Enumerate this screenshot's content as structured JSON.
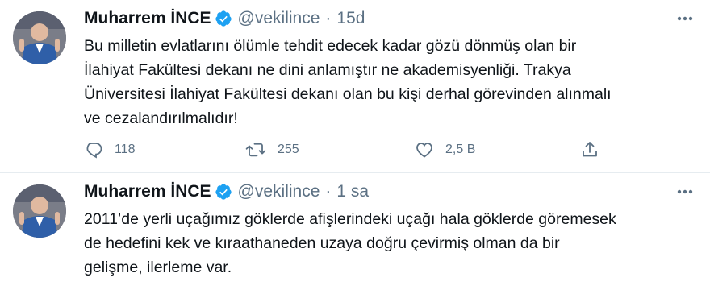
{
  "tweets": [
    {
      "author_name": "Muharrem İNCE",
      "handle": "@vekilince",
      "separator": "·",
      "time": "15d",
      "text": "Bu milletin evlatlarını ölümle tehdit edecek kadar gözü dönmüş olan bir\nİlahiyat Fakültesi dekanı ne dini anlamıştır ne akademisyenliği. Trakya\nÜniversitesi İlahiyat Fakültesi dekanı olan bu kişi derhal görevinden alınmalı\nve cezalandırılmalıdır!",
      "reply_count": "118",
      "retweet_count": "255",
      "like_count": "2,5 B"
    },
    {
      "author_name": "Muharrem İNCE",
      "handle": "@vekilince",
      "separator": "·",
      "time": "1 sa",
      "text": "2011’de yerli uçağımız göklerde afişlerindeki uçağı hala göklerde göremesek\nde hedefini kek ve kıraathaneden uzaya doğru çevirmiş olman da bir\ngelişme, ilerleme var."
    }
  ],
  "icons": {
    "verified": "verified-badge-icon",
    "more": "more-options-icon",
    "reply": "reply-icon",
    "retweet": "retweet-icon",
    "like": "like-heart-icon",
    "share": "share-icon"
  },
  "colors": {
    "verified_blue": "#1da1f2",
    "secondary_text": "#5b7083",
    "primary_text": "#0f1419",
    "divider": "#e6ecf0"
  }
}
